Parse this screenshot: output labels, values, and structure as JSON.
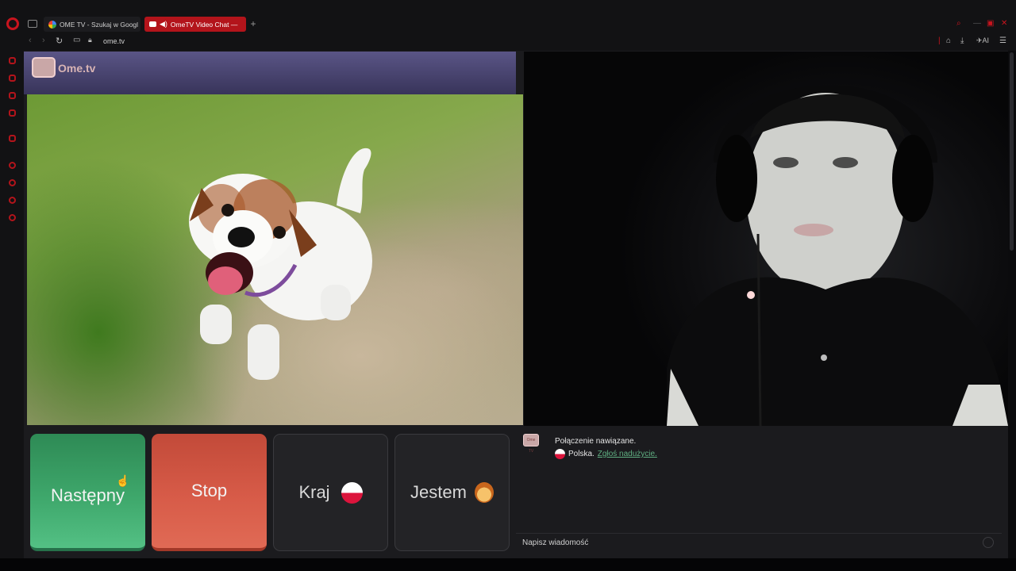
{
  "browser": {
    "tabs": [
      {
        "label": "OME TV - Szukaj w Googl"
      },
      {
        "label": "OmeTV Video Chat —"
      }
    ],
    "new_tab": "+",
    "url": "ome.tv",
    "ai_label": "AI"
  },
  "site": {
    "logo_text": "Ome.tv",
    "logo_badge": "Ome TV"
  },
  "controls": {
    "next_label": "Następny",
    "stop_label": "Stop",
    "country_label": "Kraj",
    "gender_label": "Jestem"
  },
  "chat": {
    "status_message": "Połączenie nawiązane.",
    "country_name": "Polska.",
    "report_link": "Zgłoś nadużycie.",
    "input_placeholder": "Napisz wiadomość"
  },
  "colors": {
    "next_green": "#3ea76b",
    "stop_red": "#d75b48",
    "opera_red": "#c8141e",
    "poland_red": "#dc143c"
  }
}
